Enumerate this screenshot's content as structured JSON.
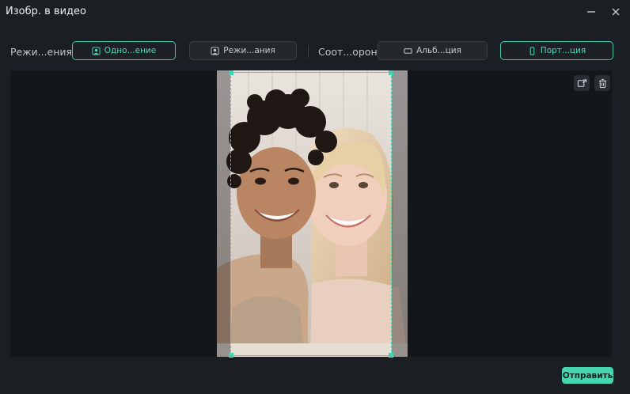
{
  "window": {
    "title": "Изобр. в видео",
    "minimize_icon": "minimize-icon",
    "close_icon": "close-icon"
  },
  "toolbar": {
    "mode_label": "Режи...ения",
    "mode_options": [
      {
        "label": "Одно...ение",
        "icon": "person-frame-icon",
        "selected": true
      },
      {
        "label": "Режи...ания",
        "icon": "person-frame-icon",
        "selected": false
      }
    ],
    "aspect_label": "Соот...орон",
    "aspect_options": [
      {
        "label": "Альб...ция",
        "icon": "landscape-icon",
        "selected": false
      },
      {
        "label": "Порт...ция",
        "icon": "portrait-icon",
        "selected": true
      }
    ]
  },
  "stage": {
    "tools": [
      {
        "icon": "replace-image-icon"
      },
      {
        "icon": "trash-icon"
      }
    ],
    "accent_color": "#46d2ae"
  },
  "footer": {
    "submit_label": "Отправить"
  },
  "colors": {
    "background": "#1b1e22",
    "stage": "#14171a",
    "accent": "#3ec9a8",
    "submit": "#48d6b0"
  }
}
